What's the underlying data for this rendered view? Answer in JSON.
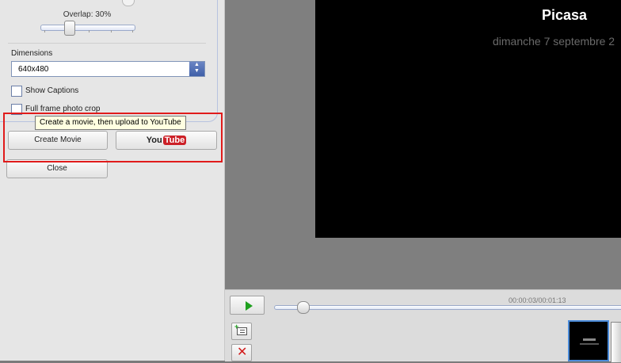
{
  "settings": {
    "overlap_label": "Overlap: 30%",
    "overlap_value_percent": 30,
    "dimensions_label": "Dimensions",
    "dimensions_value": "640x480",
    "show_captions_label": "Show Captions",
    "show_captions_checked": false,
    "full_frame_label": "Full frame photo crop",
    "full_frame_checked": false
  },
  "tooltip": {
    "text": "Create a movie, then upload to YouTube"
  },
  "actions": {
    "create_movie_label": "Create Movie",
    "youtube_you": "You",
    "youtube_tube": "Tube",
    "close_label": "Close"
  },
  "preview": {
    "title": "Picasa",
    "subtitle": "dimanche 7 septembre 2"
  },
  "playback": {
    "time": "00:00:03/00:01:13"
  },
  "colors": {
    "highlight": "#e01b1b",
    "play_icon": "#1ea01e",
    "youtube_red": "#cc2027"
  },
  "icons": {
    "play": "play-icon",
    "add_text": "add-text-slide-icon",
    "delete": "delete-icon"
  }
}
